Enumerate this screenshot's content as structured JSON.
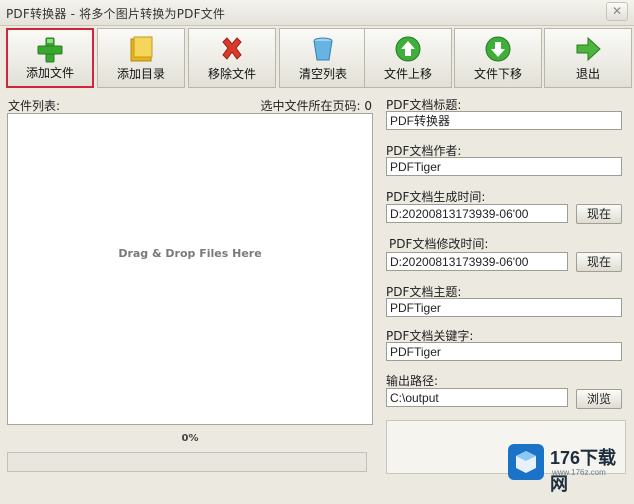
{
  "window": {
    "title": "PDF转换器 - 将多个图片转换为PDF文件",
    "close_glyph": "✕"
  },
  "toolbar": {
    "buttons": [
      {
        "label": "添加文件",
        "icon": "plus-icon",
        "active": true
      },
      {
        "label": "添加目录",
        "icon": "folder-icon"
      },
      {
        "label": "移除文件",
        "icon": "remove-x-icon"
      },
      {
        "label": "清空列表",
        "icon": "clear-bucket-icon"
      },
      {
        "label": "文件上移",
        "icon": "arrow-up-icon"
      },
      {
        "label": "文件下移",
        "icon": "arrow-down-icon"
      },
      {
        "label": "退出",
        "icon": "exit-arrow-icon"
      }
    ]
  },
  "file_panel": {
    "list_label": "文件列表:",
    "page_label": "选中文件所在页码: 0",
    "drop_hint": "Drag & Drop Files Here",
    "progress_text": "0%",
    "progress_value": 0
  },
  "pdf_fields": {
    "title_label": "PDF文档标题:",
    "title_value": "PDF转换器",
    "author_label": "PDF文档作者:",
    "author_value": "PDFTiger",
    "created_label": "PDF文档生成时间:",
    "created_value": "D:20200813173939-06'00",
    "created_now": "现在",
    "modified_label": "PDF文档修改时间:",
    "modified_value": "D:20200813173939-06'00",
    "modified_now": "现在",
    "subject_label": "PDF文档主题:",
    "subject_value": "PDFTiger",
    "keywords_label": "PDF文档关键字:",
    "keywords_value": "PDFTiger",
    "output_label": "输出路径:",
    "output_value": "C:\\output",
    "browse_label": "浏览"
  },
  "watermark": {
    "brand": "176下载网",
    "sub": "www.176z.com"
  },
  "colors": {
    "active_border": "#d0263c",
    "progress_fill": "#6bbf59"
  }
}
